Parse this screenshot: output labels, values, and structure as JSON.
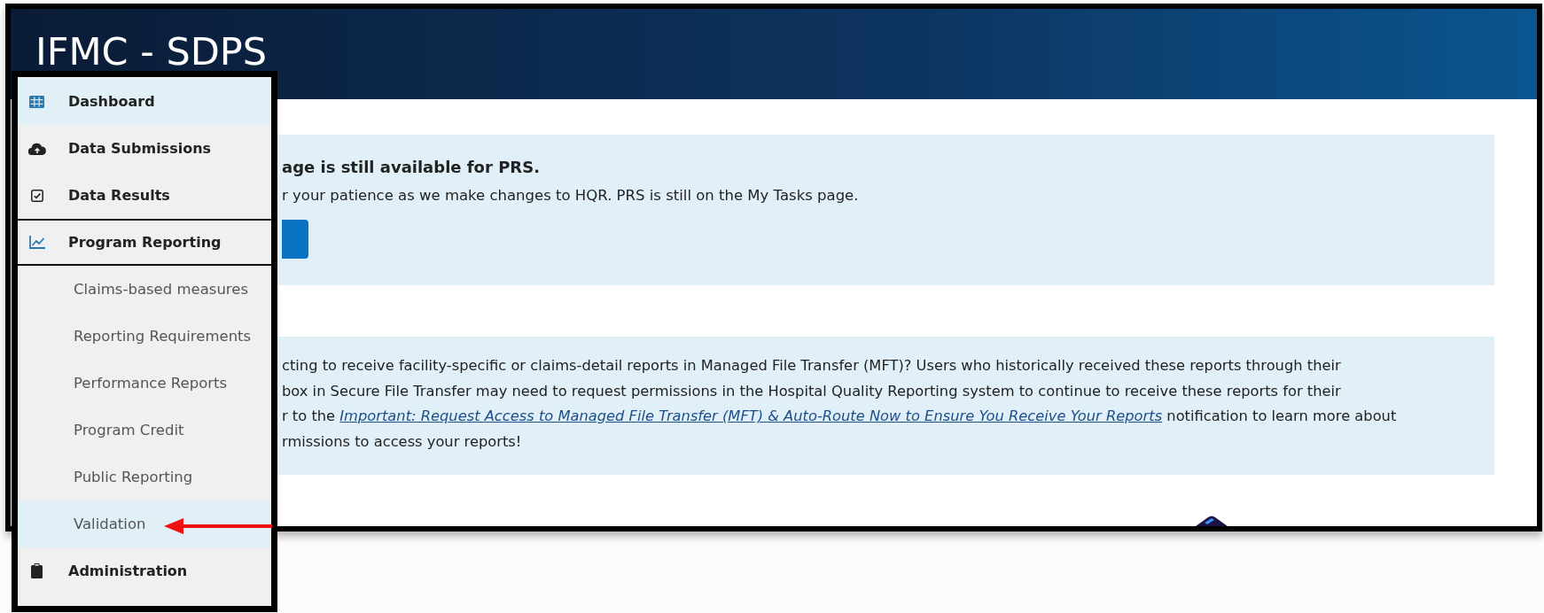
{
  "header": {
    "title": "IFMC - SDPS"
  },
  "notice": {
    "heading": "age is still available for PRS.",
    "text": "r your patience as we make changes to HQR. PRS is still on the My Tasks page."
  },
  "mft_notice": {
    "lines": [
      {
        "text": "cting to receive facility-specific or claims-detail reports in Managed File Transfer (MFT)? Users who historically received these reports through their"
      },
      {
        "text": "box in Secure File Transfer may need to request permissions in the Hospital Quality Reporting system to continue to receive these reports for their"
      },
      {
        "text": "r to the ",
        "link": "Important: Request Access to Managed File Transfer (MFT) & Auto-Route Now to Ensure You Receive Your Reports",
        "after": " notification to learn more about"
      },
      {
        "text": "rmissions to access your reports!"
      }
    ]
  },
  "menu": {
    "items": [
      {
        "label": "Dashboard",
        "selected": true,
        "expanded": false
      },
      {
        "label": "Data Submissions",
        "selected": false,
        "expanded": false
      },
      {
        "label": "Data Results",
        "selected": false,
        "expanded": false
      },
      {
        "label": "Program Reporting",
        "selected": false,
        "expanded": true,
        "children": [
          {
            "label": "Claims-based measures",
            "selected": false
          },
          {
            "label": "Reporting Requirements",
            "selected": false
          },
          {
            "label": "Performance Reports",
            "selected": false
          },
          {
            "label": "Program Credit",
            "selected": false
          },
          {
            "label": "Public Reporting",
            "selected": false
          },
          {
            "label": "Validation",
            "selected": true
          }
        ]
      },
      {
        "label": "Administration",
        "selected": false,
        "expanded": false
      }
    ]
  }
}
